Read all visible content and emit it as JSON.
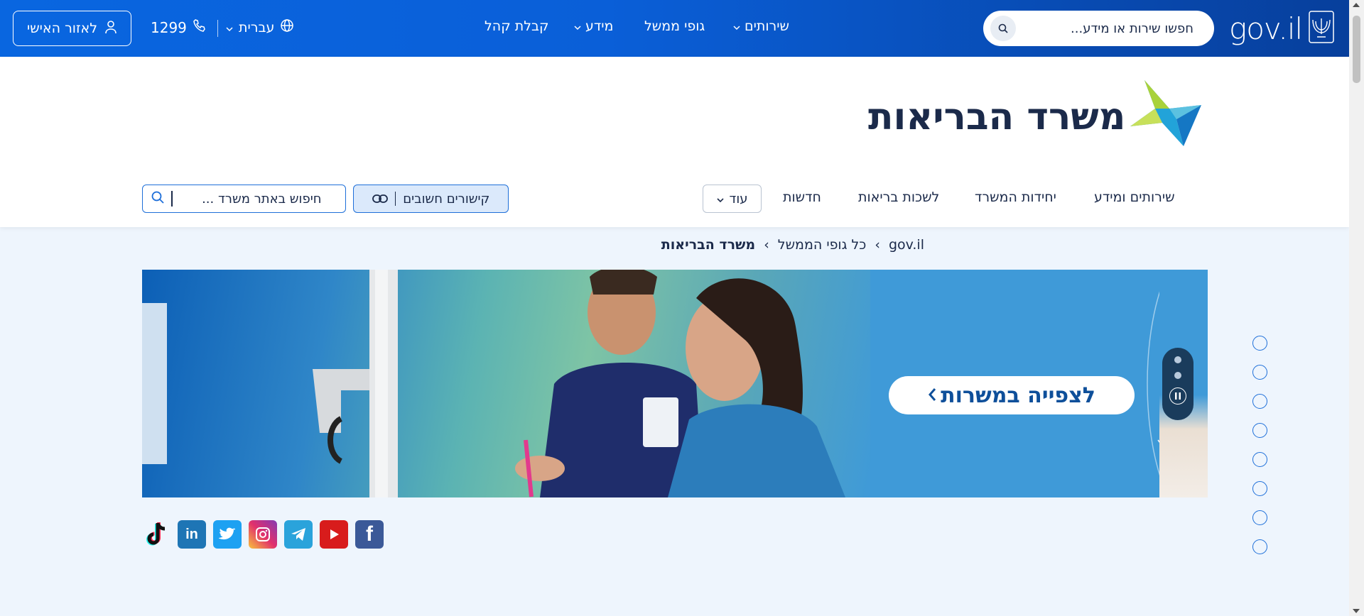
{
  "topbar": {
    "personal_label": "לאזור האישי",
    "phone": "1299",
    "language": "עברית",
    "nav": [
      "קבלת קהל",
      "מידע",
      "גופי ממשל",
      "שירותים"
    ],
    "search_placeholder": "חפשו שירות או מידע...",
    "logo_text": "gov.il"
  },
  "ministry": {
    "title": "משרד הבריאות",
    "subnav": [
      "שירותים ומידע",
      "יחידות המשרד",
      "לשכות בריאות",
      "חדשות"
    ],
    "more_label": "עוד",
    "links_label": "קישורים חשובים",
    "search_placeholder": "חיפוש באתר משרד ..."
  },
  "breadcrumb": {
    "items": [
      "gov.il",
      "כל גופי הממשל",
      "משרד הבריאות"
    ]
  },
  "banner": {
    "cta": "לצפייה במשרות"
  },
  "social": [
    {
      "name": "facebook",
      "glyph": "f",
      "color": "#3b5998"
    },
    {
      "name": "youtube",
      "glyph": "▶",
      "color": "#d81c1c"
    },
    {
      "name": "telegram",
      "glyph": "➤",
      "color": "#2aa3db"
    },
    {
      "name": "instagram",
      "glyph": "◎",
      "color": "#c13584"
    },
    {
      "name": "twitter",
      "glyph": "🐦",
      "color": "#1da1f2"
    },
    {
      "name": "linkedin",
      "glyph": "in",
      "color": "#1e75b5"
    },
    {
      "name": "tiktok",
      "glyph": "♪",
      "color": "#111111"
    }
  ],
  "colors": {
    "topbar": "#0966e0",
    "accent": "#1e6fd9",
    "text": "#1b2a4a",
    "page_bg": "#eef5fd"
  }
}
